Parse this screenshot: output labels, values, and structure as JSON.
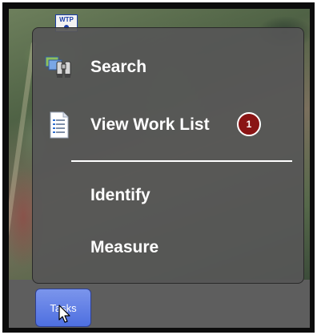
{
  "map": {
    "badge_text": "WTP"
  },
  "menu": {
    "items": [
      {
        "label": "Search",
        "icon": "binoculars-icon"
      },
      {
        "label": "View Work List",
        "icon": "document-list-icon",
        "badge_count": "1"
      },
      {
        "label": "Identify"
      },
      {
        "label": "Measure"
      }
    ]
  },
  "taskbar": {
    "tasks_label": "Tasks"
  },
  "colors": {
    "menu_background": "#565656",
    "badge_red": "#8a1414",
    "button_blue": "#5b7be4"
  }
}
